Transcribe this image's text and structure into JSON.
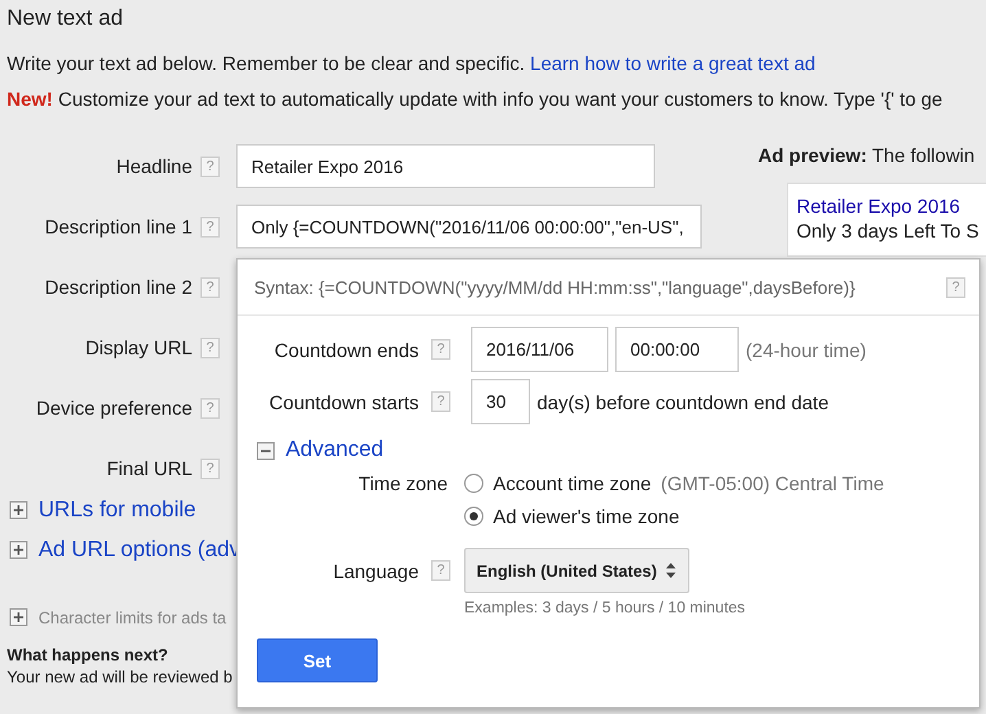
{
  "title": "New text ad",
  "help_glyph": "?",
  "intro": {
    "text": "Write your text ad below. Remember to be clear and specific.",
    "link": "Learn how to write a great text ad"
  },
  "notice": {
    "badge": "New!",
    "text": "Customize your ad text to automatically update with info you want your customers to know. Type '{' to ge"
  },
  "form_rows": [
    {
      "label": "Headline",
      "value": "Retailer Expo 2016"
    },
    {
      "label": "Description line 1",
      "value": "Only {=COUNTDOWN(\"2016/11/06 00:00:00\",\"en-US\","
    },
    {
      "label": "Description line 2"
    },
    {
      "label": "Display URL"
    },
    {
      "label": "Device preference"
    },
    {
      "label": "Final URL"
    }
  ],
  "expanders": [
    {
      "label": "URLs for mobile",
      "expanded": false
    },
    {
      "label": "Ad URL options (adv",
      "expanded": false
    }
  ],
  "char_limits": {
    "label": "Character limits for ads ta",
    "expanded": false
  },
  "next": {
    "title": "What happens next?",
    "text": "Your new ad will be reviewed b"
  },
  "preview": {
    "label": "Ad preview:",
    "text": "The followin",
    "headline": "Retailer Expo 2016",
    "line": "Only 3 days Left To S"
  },
  "popup": {
    "syntax": "Syntax: {=COUNTDOWN(\"yyyy/MM/dd HH:mm:ss\",\"language\",daysBefore)}",
    "ends": {
      "label": "Countdown ends",
      "date": "2016/11/06",
      "time": "00:00:00",
      "hint": "(24-hour time)"
    },
    "starts": {
      "label": "Countdown starts",
      "days": "30",
      "hint": "day(s) before countdown end date"
    },
    "advanced": {
      "label": "Advanced",
      "expanded": true
    },
    "time_zone": {
      "label": "Time zone",
      "options": [
        {
          "label": "Account time zone",
          "detail": "(GMT-05:00) Central Time",
          "selected": false
        },
        {
          "label": "Ad viewer's time zone",
          "selected": true
        }
      ]
    },
    "language": {
      "label": "Language",
      "value": "English (United States)",
      "examples": "Examples: 3 days / 5 hours / 10 minutes"
    },
    "button": "Set"
  }
}
